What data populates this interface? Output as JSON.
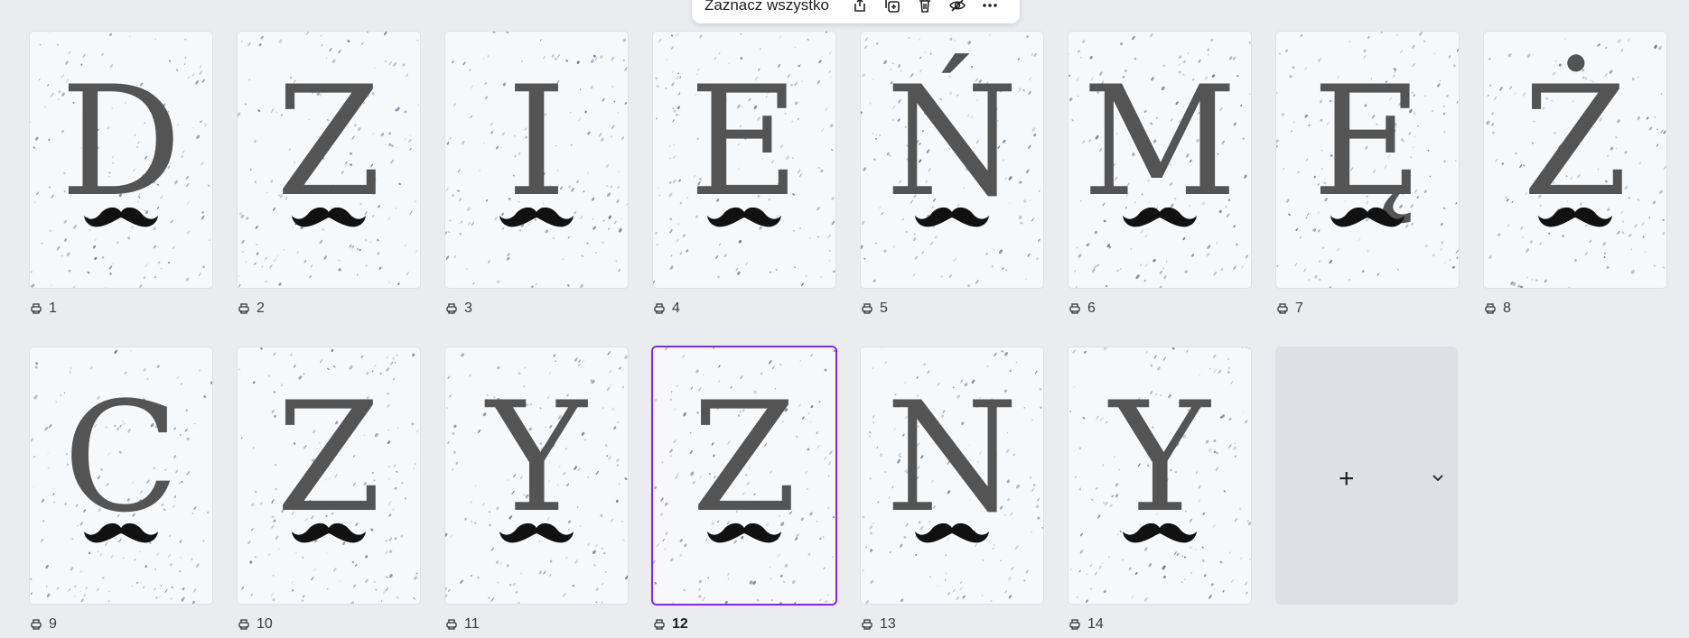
{
  "toolbar": {
    "select_all_label": "Zaznacz wszystko",
    "icons": [
      "share-icon",
      "duplicate-icon",
      "trash-icon",
      "hide-icon",
      "more-icon"
    ]
  },
  "pages": [
    {
      "number": "1",
      "letter": "D"
    },
    {
      "number": "2",
      "letter": "Z"
    },
    {
      "number": "3",
      "letter": "I"
    },
    {
      "number": "4",
      "letter": "E"
    },
    {
      "number": "5",
      "letter": "Ń"
    },
    {
      "number": "6",
      "letter": "M"
    },
    {
      "number": "7",
      "letter": "Ę"
    },
    {
      "number": "8",
      "letter": "Ż"
    },
    {
      "number": "9",
      "letter": "C"
    },
    {
      "number": "10",
      "letter": "Z"
    },
    {
      "number": "11",
      "letter": "Y"
    },
    {
      "number": "12",
      "letter": "Z",
      "selected": true
    },
    {
      "number": "13",
      "letter": "N"
    },
    {
      "number": "14",
      "letter": "Y"
    }
  ],
  "add_page": {
    "plus_glyph": "+"
  },
  "colors": {
    "accent": "#7d2ae8",
    "letter": "#545454",
    "background": "#ebecf0"
  }
}
